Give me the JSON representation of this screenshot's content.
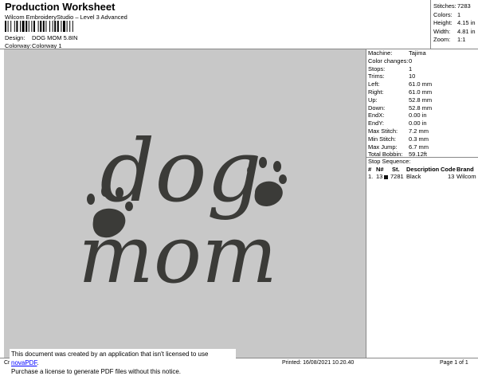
{
  "header": {
    "title": "Production Worksheet",
    "subtitle": "Wilcom EmbroideryStudio – Level 3 Advanced",
    "design_label": "Design:",
    "design_value": "DOG MOM 5.8IN",
    "colorway_label": "Colorway:",
    "colorway_value": "Colorway 1"
  },
  "stats": [
    {
      "label": "Stitches:",
      "value": "7283"
    },
    {
      "label": "Colors:",
      "value": "1"
    },
    {
      "label": "Height:",
      "value": "4.15 in"
    },
    {
      "label": "Width:",
      "value": "4.81 in"
    },
    {
      "label": "Zoom:",
      "value": "1:1"
    }
  ],
  "machine": [
    {
      "label": "Machine:",
      "value": "Tajima"
    },
    {
      "label": "Color changes:",
      "value": "0"
    },
    {
      "label": "Stops:",
      "value": "1"
    },
    {
      "label": "Trims:",
      "value": "10"
    },
    {
      "label": "Left:",
      "value": "61.0 mm"
    },
    {
      "label": "Right:",
      "value": "61.0 mm"
    },
    {
      "label": "Up:",
      "value": "52.8 mm"
    },
    {
      "label": "Down:",
      "value": "52.8 mm"
    },
    {
      "label": "EndX:",
      "value": "0.00 in"
    },
    {
      "label": "EndY:",
      "value": "0.00 in"
    },
    {
      "label": "Max Stitch:",
      "value": "7.2 mm"
    },
    {
      "label": "Min Stitch:",
      "value": "0.3 mm"
    },
    {
      "label": "Max Jump:",
      "value": "6.7 mm"
    },
    {
      "label": "Total Bobbin:",
      "value": "59.12ft"
    }
  ],
  "stop_sequence": {
    "title": "Stop Sequence:",
    "headers": {
      "num": "#",
      "n": "N#",
      "st": "St.",
      "desc": "Description",
      "code": "Code",
      "brand": "Brand"
    },
    "rows": [
      {
        "num": "1.",
        "n": "13",
        "st": "7281",
        "desc": "Black",
        "code": "13",
        "brand": "Wilcom",
        "color": "#111111"
      }
    ]
  },
  "design_art": {
    "text_line1": "dog",
    "text_line2": "mom",
    "thread_color": "#3b3b38",
    "background_color": "#c8c8c8"
  },
  "footer": {
    "left": "Cr",
    "printed": "Printed: 16/08/2021 10.20.40",
    "page": "Page 1 of 1"
  },
  "banner": {
    "line1_prefix": "This document was created by an application that isn't licensed to use ",
    "link": "novaPDF",
    "line1_suffix": ".",
    "line2": "Purchase a license to generate PDF files without this notice."
  }
}
